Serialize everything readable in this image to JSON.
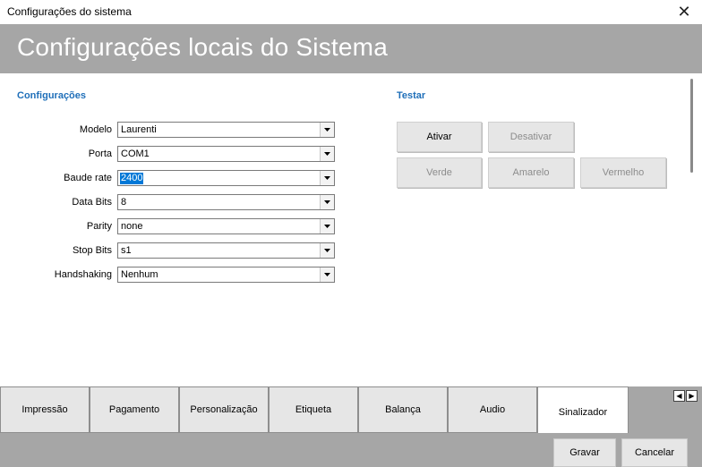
{
  "window": {
    "title": "Configurações do sistema",
    "close_glyph": "✕"
  },
  "banner": {
    "title": "Configurações locais do Sistema"
  },
  "config": {
    "heading": "Configurações",
    "fields": [
      {
        "label": "Modelo",
        "value": "Laurenti"
      },
      {
        "label": "Porta",
        "value": "COM1"
      },
      {
        "label": "Baude rate",
        "value": "2400"
      },
      {
        "label": "Data Bits",
        "value": "8"
      },
      {
        "label": "Parity",
        "value": "none"
      },
      {
        "label": "Stop Bits",
        "value": "s1"
      },
      {
        "label": "Handshaking",
        "value": "Nenhum"
      }
    ]
  },
  "test": {
    "heading": "Testar",
    "ativar": "Ativar",
    "desativar": "Desativar",
    "verde": "Verde",
    "amarelo": "Amarelo",
    "vermelho": "Vermelho"
  },
  "tabs": [
    {
      "label": "Impressão",
      "active": false
    },
    {
      "label": "Pagamento",
      "active": false
    },
    {
      "label": "Personalização",
      "active": false
    },
    {
      "label": "Etiqueta",
      "active": false
    },
    {
      "label": "Balança",
      "active": false
    },
    {
      "label": "Audio",
      "active": false
    },
    {
      "label": "Sinalizador",
      "active": true
    }
  ],
  "tab_scroll": {
    "left": "◀",
    "right": "▶"
  },
  "footer": {
    "save": "Gravar",
    "cancel": "Cancelar"
  },
  "colors": {
    "accent": "#1f6fb9",
    "banner": "#a6a6a6",
    "selection": "#0078d7"
  },
  "icons": [
    "close-icon",
    "chevron-down-icon",
    "tab-scroll-left-icon",
    "tab-scroll-right-icon"
  ]
}
